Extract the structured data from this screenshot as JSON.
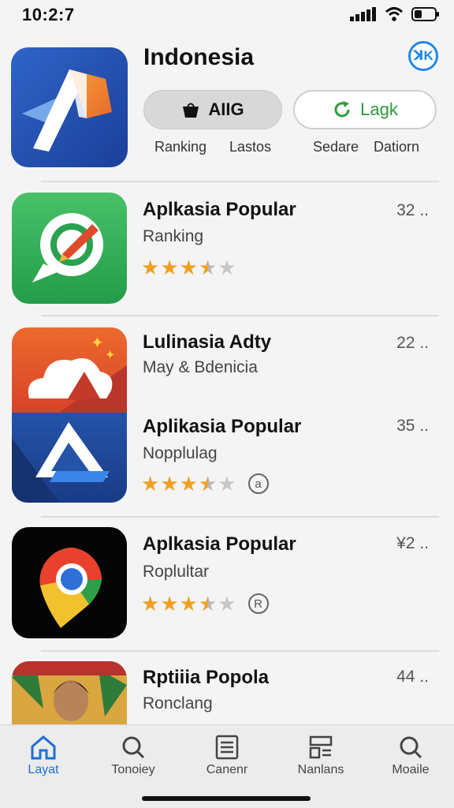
{
  "status_bar": {
    "time": "10:2:7"
  },
  "header": {
    "title": "Indonesia",
    "badge": "ꓘK",
    "primary_button": {
      "label": "AIIG",
      "icon": "bag-icon"
    },
    "secondary_button": {
      "label": "Lagk",
      "icon": "refresh-icon"
    },
    "sub_labels": [
      "Ranking",
      "Lastos",
      "Sedare",
      "Datiorn"
    ]
  },
  "apps": [
    {
      "title": "Aplkasia Popular",
      "subtitle": "Ranking",
      "meta": "32 ..",
      "rating": 3.5,
      "icon": "chat-bubble-app-icon"
    },
    {
      "title": "Lulinasia Adty",
      "subtitle": "May & Bdenicia",
      "meta": "22 ..",
      "icon": "cloud-mountain-app-icon"
    },
    {
      "title": "Aplikasia Popular",
      "subtitle": "Nopplulag",
      "meta": "35 ..",
      "rating": 3.5,
      "badge": "a",
      "icon": "drive-triangle-app-icon"
    },
    {
      "title": "Aplkasia Popular",
      "subtitle": "Roplultar",
      "meta": "¥2 ..",
      "rating": 3.5,
      "badge": "R",
      "icon": "map-pin-app-icon"
    },
    {
      "title": "Rptiiia Popola",
      "subtitle": "Ronclang",
      "meta": "44 ..",
      "icon": "portrait-app-icon"
    }
  ],
  "tab_bar": {
    "tabs": [
      {
        "label": "Layat",
        "icon": "home-icon",
        "active": true
      },
      {
        "label": "Tonoiey",
        "icon": "search-icon"
      },
      {
        "label": "Canenr",
        "icon": "list-icon"
      },
      {
        "label": "Nanlans",
        "icon": "grid-icon"
      },
      {
        "label": "Moaile",
        "icon": "search-icon"
      }
    ]
  },
  "colors": {
    "accent": "#1e6fd6",
    "star": "#f0a020",
    "green": "#2e9b3f"
  }
}
